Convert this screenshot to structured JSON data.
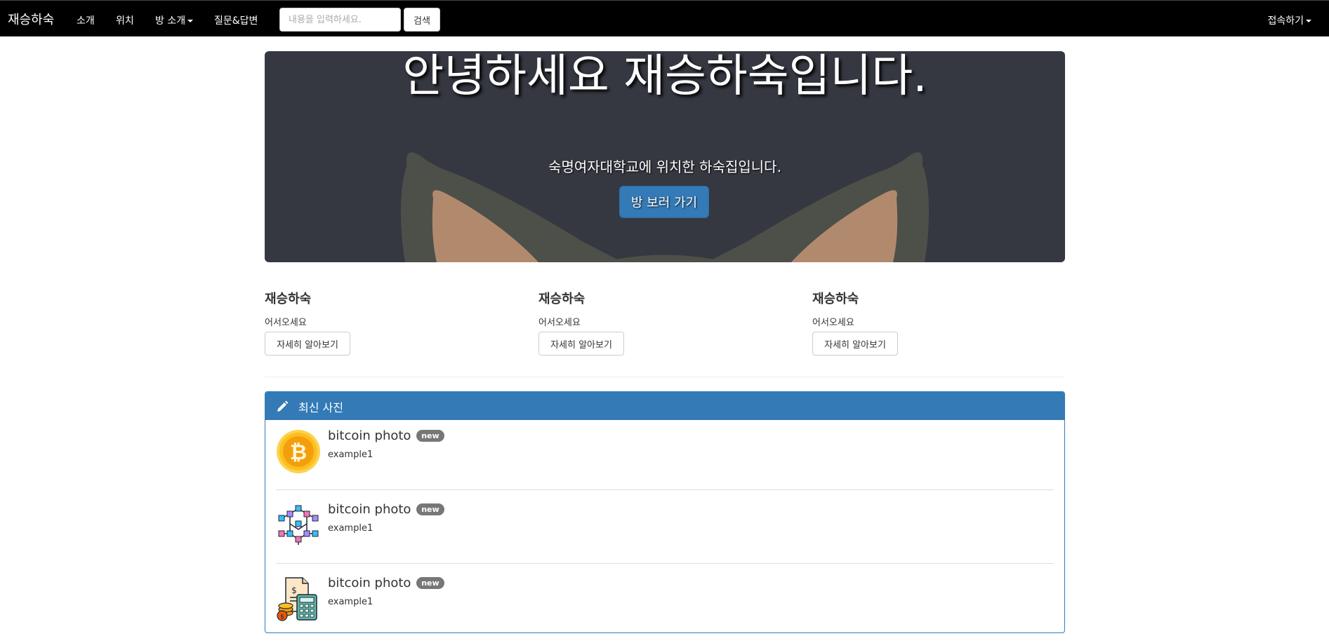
{
  "navbar": {
    "brand": "재승하숙",
    "items": [
      "소개",
      "위치",
      "방 소개",
      "질문&답변"
    ],
    "search_placeholder": "내용을 입력하세요.",
    "search_button": "검색",
    "connect": "접속하기"
  },
  "jumbotron": {
    "title": "안녕하세요 재승하숙입니다.",
    "subtitle": "숙명여자대학교에 위치한 하숙집입니다.",
    "button": "방 보러 가기"
  },
  "features": [
    {
      "title": "재승하숙",
      "text": "어서오세요",
      "button": "자세히 알아보기"
    },
    {
      "title": "재승하숙",
      "text": "어서오세요",
      "button": "자세히 알아보기"
    },
    {
      "title": "재승하숙",
      "text": "어서오세요",
      "button": "자세히 알아보기"
    }
  ],
  "panel": {
    "title": "최신 사진",
    "items": [
      {
        "heading": "bitcoin photo",
        "badge": "new",
        "sub": "example1",
        "icon": "bitcoin-coin-icon"
      },
      {
        "heading": "bitcoin photo",
        "badge": "new",
        "sub": "example1",
        "icon": "blockchain-network-icon"
      },
      {
        "heading": "bitcoin photo",
        "badge": "new",
        "sub": "example1",
        "icon": "calculator-invoice-icon"
      }
    ]
  },
  "colors": {
    "navbar": "#000000",
    "jumbotron": "#353841",
    "primary": "#337ab7",
    "badge": "#777777"
  }
}
